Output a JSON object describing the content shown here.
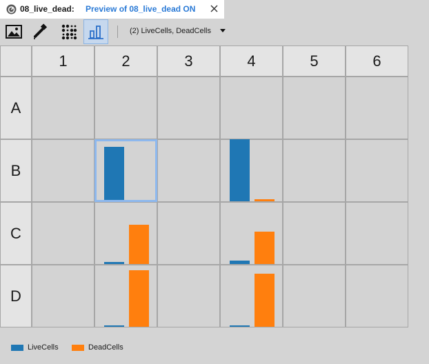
{
  "tab": {
    "title": "08_live_dead:",
    "preview_label": "Preview of 08_live_dead  ON"
  },
  "toolbar": {
    "buttons": [
      {
        "name": "image-view",
        "icon": "image-icon",
        "active": false
      },
      {
        "name": "pipette-view",
        "icon": "pipette-icon",
        "active": false
      },
      {
        "name": "dot-plot-view",
        "icon": "dot-grid-icon",
        "active": false
      },
      {
        "name": "bar-chart-view",
        "icon": "bar-chart-icon",
        "active": true
      }
    ],
    "measure_select": {
      "value": "(2) LiveCells, DeadCells"
    }
  },
  "plate": {
    "columns": [
      "1",
      "2",
      "3",
      "4",
      "5",
      "6"
    ],
    "rows": [
      "A",
      "B",
      "C",
      "D"
    ],
    "selected_well": "B2"
  },
  "colors": {
    "LiveCells": "#1f77b4",
    "DeadCells": "#ff7f0e",
    "selection": "#8db8ee"
  },
  "chart_data": {
    "type": "bar",
    "layout": "per-well small multiples",
    "series": [
      {
        "name": "LiveCells"
      },
      {
        "name": "DeadCells"
      }
    ],
    "scale_max": 1.0,
    "wells": [
      {
        "well": "B2",
        "LiveCells": 0.86,
        "DeadCells": 0.0
      },
      {
        "well": "B4",
        "LiveCells": 1.0,
        "DeadCells": 0.03
      },
      {
        "well": "C2",
        "LiveCells": 0.03,
        "DeadCells": 0.63
      },
      {
        "well": "C4",
        "LiveCells": 0.05,
        "DeadCells": 0.52
      },
      {
        "well": "D2",
        "LiveCells": 0.01,
        "DeadCells": 0.91
      },
      {
        "well": "D4",
        "LiveCells": 0.02,
        "DeadCells": 0.86
      }
    ]
  },
  "legend": [
    {
      "label": "LiveCells"
    },
    {
      "label": "DeadCells"
    }
  ]
}
